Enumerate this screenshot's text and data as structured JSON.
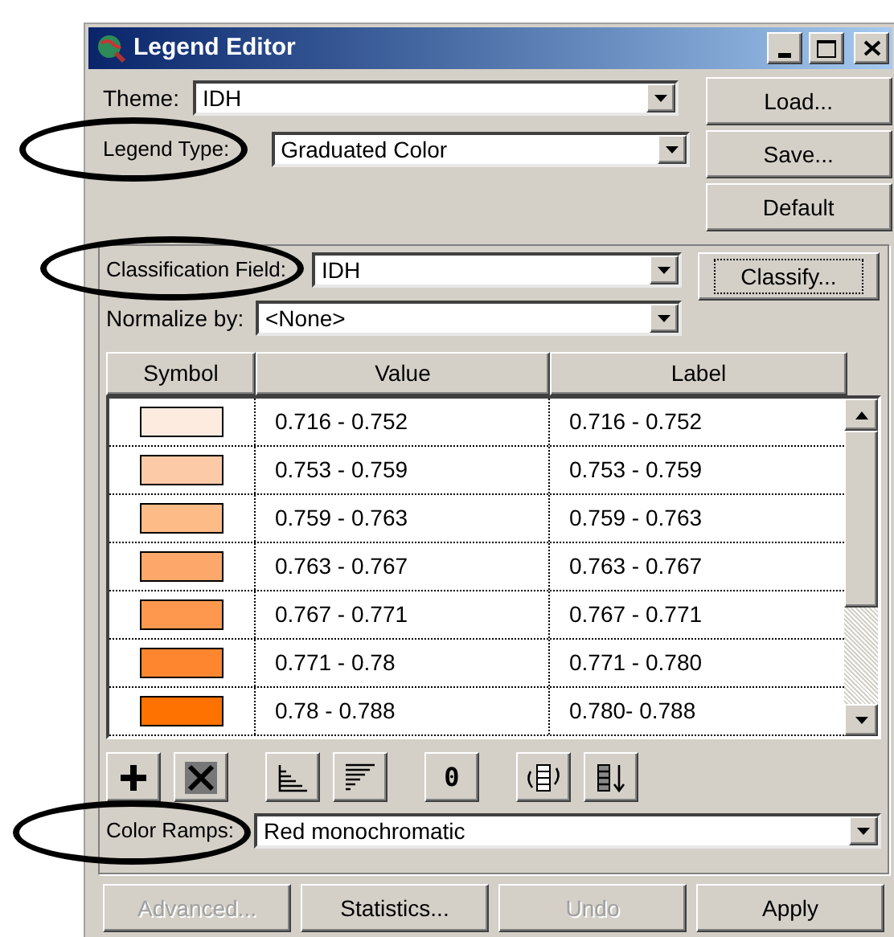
{
  "window": {
    "title": "Legend Editor"
  },
  "theme": {
    "label": "Theme:",
    "value": "IDH"
  },
  "legend_type": {
    "label": "Legend Type:",
    "value": "Graduated Color"
  },
  "side_buttons": [
    {
      "label": "Load...",
      "focused": false
    },
    {
      "label": "Save...",
      "focused": false
    },
    {
      "label": "Default",
      "focused": false
    }
  ],
  "classification_field": {
    "label": "Classification Field:",
    "value": "IDH"
  },
  "classify_button": {
    "label": "Classify...",
    "focused": true
  },
  "normalize_by": {
    "label": "Normalize by:",
    "value": "<None>"
  },
  "table": {
    "columns": [
      "Symbol",
      "Value",
      "Label"
    ],
    "rows": [
      {
        "color": "#fdebdf",
        "value": "0.716 - 0.752",
        "label": "0.716 - 0.752"
      },
      {
        "color": "#fdcaa8",
        "value": "0.753 - 0.759",
        "label": "0.753 - 0.759"
      },
      {
        "color": "#fdbb88",
        "value": "0.759 - 0.763",
        "label": "0.759 - 0.763"
      },
      {
        "color": "#fda86a",
        "value": "0.763 - 0.767",
        "label": "0.763 - 0.767"
      },
      {
        "color": "#fd984e",
        "value": "0.767 - 0.771",
        "label": "0.767 - 0.771"
      },
      {
        "color": "#fd862e",
        "value": "0.771 - 0.78",
        "label": "0.771 - 0.780"
      },
      {
        "color": "#fd7200",
        "value": "0.78 - 0.788",
        "label": "0.780- 0.788"
      }
    ]
  },
  "toolbar": [
    {
      "kind": "add"
    },
    {
      "kind": "delete"
    },
    {
      "kind": "sort-ascending"
    },
    {
      "kind": "sort-descending"
    },
    {
      "kind": "text",
      "label": "0"
    },
    {
      "kind": "flip"
    },
    {
      "kind": "reverse"
    }
  ],
  "color_ramp": {
    "label": "Color Ramps:",
    "value": "Red monochromatic"
  },
  "bottom_buttons": [
    {
      "label": "Advanced...",
      "disabled": true
    },
    {
      "label": "Statistics...",
      "disabled": false
    },
    {
      "label": "Undo",
      "disabled": true
    },
    {
      "label": "Apply",
      "disabled": false
    }
  ]
}
